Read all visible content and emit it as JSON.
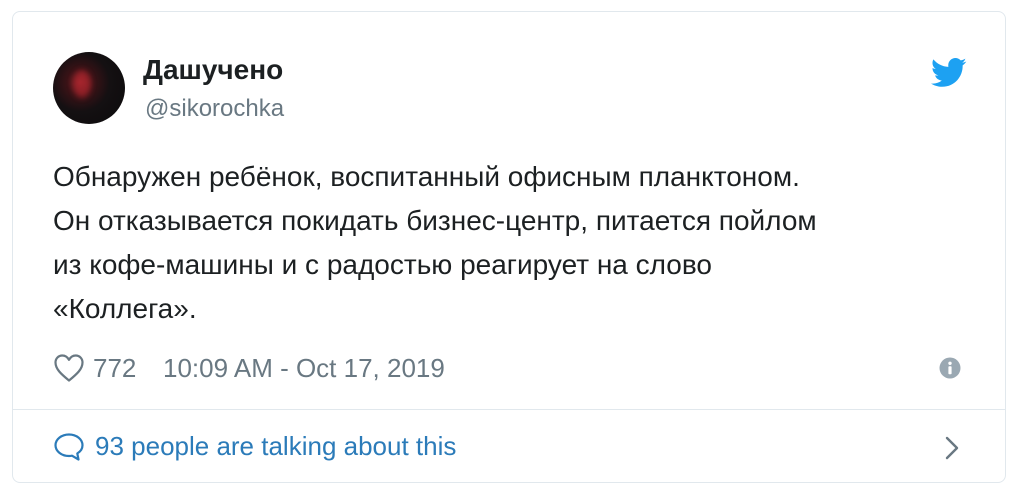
{
  "author": {
    "display_name": "Дашучено",
    "handle": "@sikorochka"
  },
  "tweet": {
    "lines": [
      "Обнаружен ребёнок, воспитанный офисным планктоном.",
      "Он отказывается покидать бизнес-центр, питается пойлом",
      "из кофе-машины и с радостью реагирует на слово",
      "«Коллега»."
    ]
  },
  "meta": {
    "like_count": "772",
    "timestamp": "10:09 AM - Oct 17, 2019"
  },
  "conversation": {
    "label": "93 people are talking about this"
  },
  "icons": {
    "logo": "twitter-bird-icon",
    "like": "heart-icon",
    "info": "info-icon",
    "comment": "comment-icon",
    "chevron": "chevron-right-icon"
  },
  "colors": {
    "brand": "#1da1f2",
    "text": "#1c2022",
    "muted": "#697882",
    "link": "#2b7bb9",
    "border": "#e1e8ed"
  }
}
